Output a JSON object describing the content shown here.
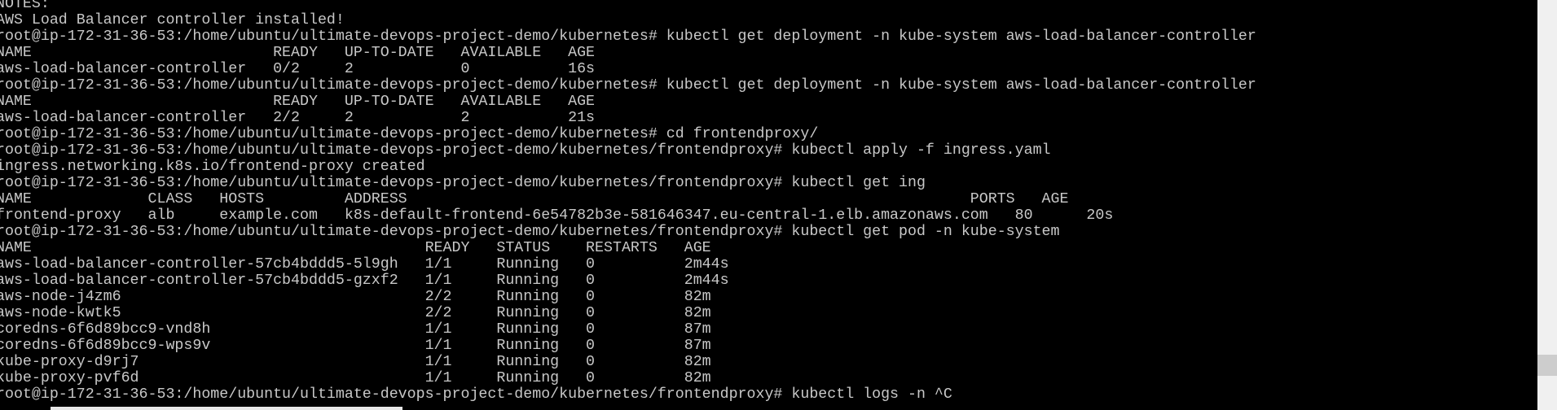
{
  "terminal": {
    "lines": [
      "NOTES:",
      "AWS Load Balancer controller installed!",
      "root@ip-172-31-36-53:/home/ubuntu/ultimate-devops-project-demo/kubernetes# kubectl get deployment -n kube-system aws-load-balancer-controller",
      "NAME                           READY   UP-TO-DATE   AVAILABLE   AGE",
      "aws-load-balancer-controller   0/2     2            0           16s",
      "root@ip-172-31-36-53:/home/ubuntu/ultimate-devops-project-demo/kubernetes# kubectl get deployment -n kube-system aws-load-balancer-controller",
      "NAME                           READY   UP-TO-DATE   AVAILABLE   AGE",
      "aws-load-balancer-controller   2/2     2            2           21s",
      "root@ip-172-31-36-53:/home/ubuntu/ultimate-devops-project-demo/kubernetes# cd frontendproxy/",
      "root@ip-172-31-36-53:/home/ubuntu/ultimate-devops-project-demo/kubernetes/frontendproxy# kubectl apply -f ingress.yaml",
      "ingress.networking.k8s.io/frontend-proxy created",
      "root@ip-172-31-36-53:/home/ubuntu/ultimate-devops-project-demo/kubernetes/frontendproxy# kubectl get ing",
      "NAME             CLASS   HOSTS         ADDRESS                                                               PORTS   AGE",
      "frontend-proxy   alb     example.com   k8s-default-frontend-6e54782b3e-581646347.eu-central-1.elb.amazonaws.com   80      20s",
      "root@ip-172-31-36-53:/home/ubuntu/ultimate-devops-project-demo/kubernetes/frontendproxy# kubectl get pod -n kube-system",
      "NAME                                            READY   STATUS    RESTARTS   AGE",
      "aws-load-balancer-controller-57cb4bddd5-5l9gh   1/1     Running   0          2m44s",
      "aws-load-balancer-controller-57cb4bddd5-gzxf2   1/1     Running   0          2m44s",
      "aws-node-j4zm6                                  2/2     Running   0          82m",
      "aws-node-kwtk5                                  2/2     Running   0          82m",
      "coredns-6f6d89bcc9-vnd8h                        1/1     Running   0          87m",
      "coredns-6f6d89bcc9-wps9v                        1/1     Running   0          87m",
      "kube-proxy-d9rj7                                1/1     Running   0          82m",
      "kube-proxy-pvf6d                                1/1     Running   0          82m",
      "root@ip-172-31-36-53:/home/ubuntu/ultimate-devops-project-demo/kubernetes/frontendproxy# kubectl logs -n ^C"
    ]
  }
}
